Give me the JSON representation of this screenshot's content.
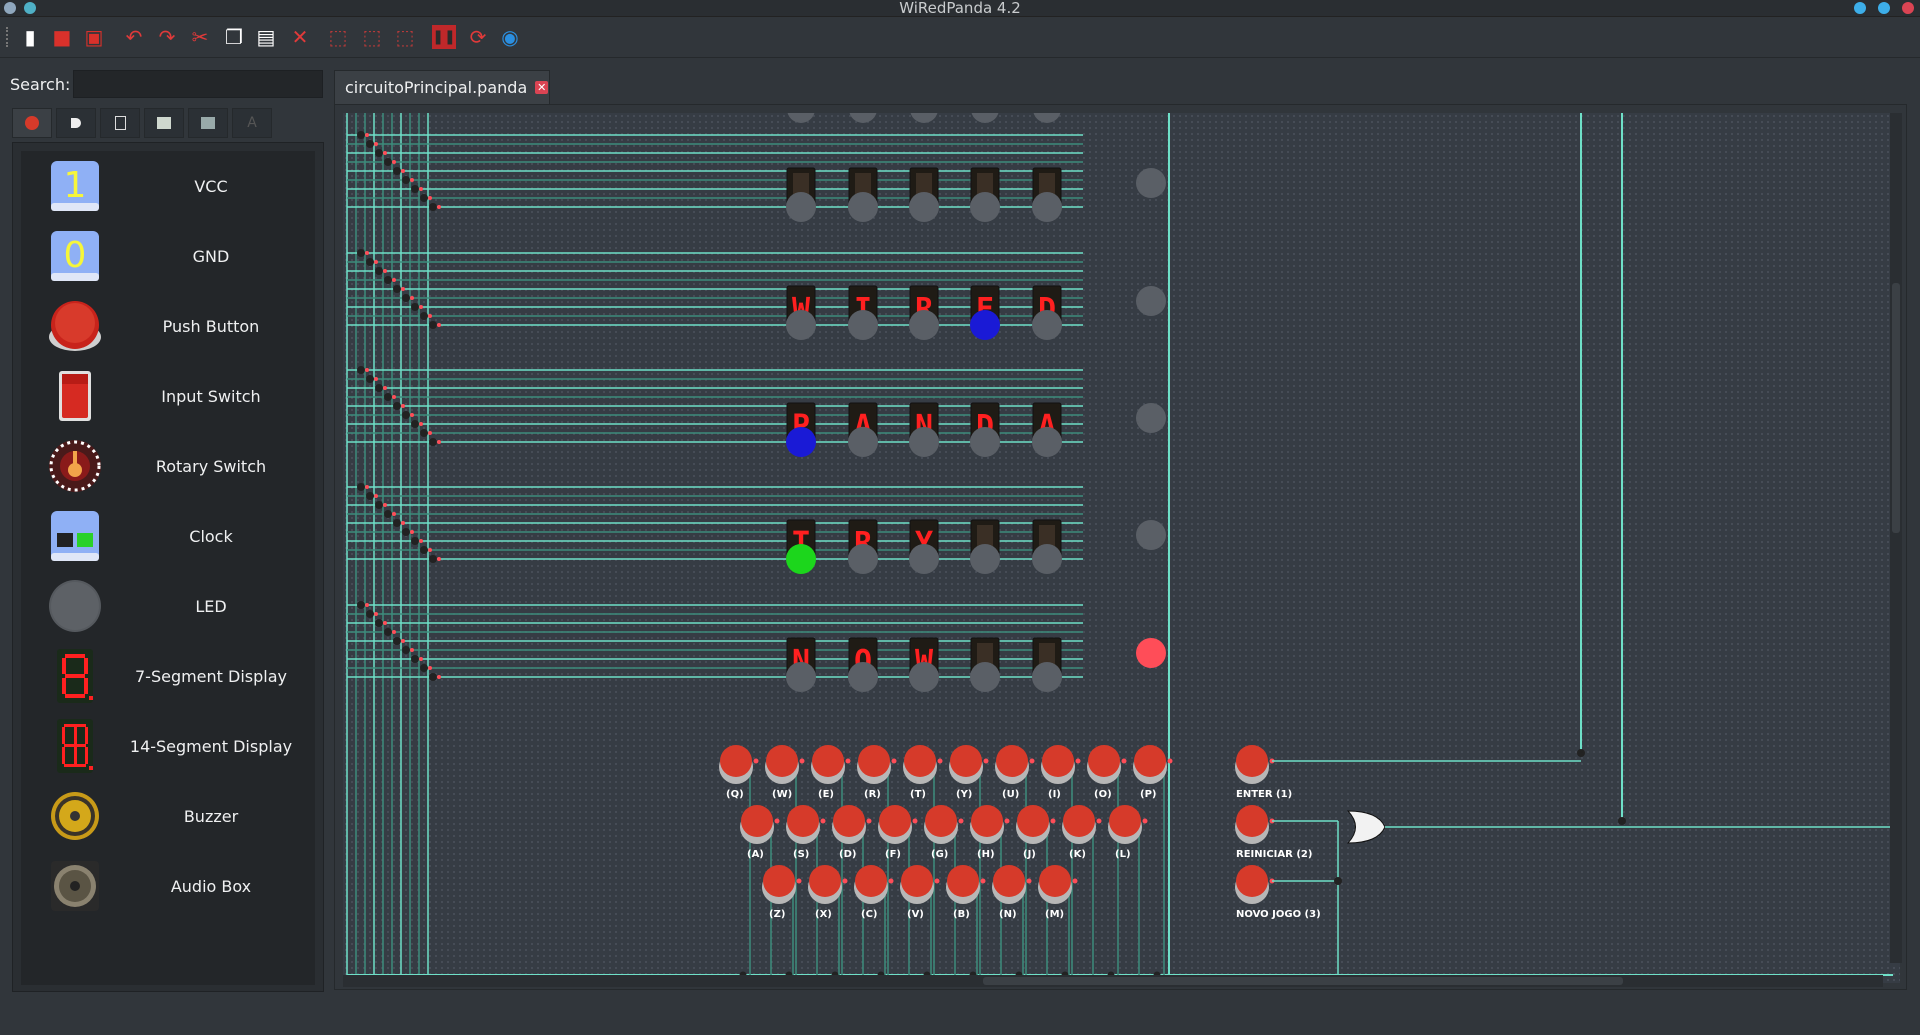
{
  "window": {
    "title": "WiRedPanda 4.2"
  },
  "toolbar": {
    "buttons": [
      {
        "name": "new-file-icon",
        "glyph": "▮",
        "color": "#ffffff"
      },
      {
        "name": "open-folder-icon",
        "glyph": "■",
        "color": "#d9312b"
      },
      {
        "name": "save-icon",
        "glyph": "▣",
        "color": "#d9312b"
      },
      {
        "name": "undo-icon",
        "glyph": "↶",
        "color": "#e03a3a"
      },
      {
        "name": "redo-icon",
        "glyph": "↷",
        "color": "#e03a3a"
      },
      {
        "name": "cut-icon",
        "glyph": "✂",
        "color": "#e03a3a"
      },
      {
        "name": "copy-icon",
        "glyph": "❐",
        "color": "#ffffff"
      },
      {
        "name": "paste-icon",
        "glyph": "▤",
        "color": "#ffffff"
      },
      {
        "name": "delete-icon",
        "glyph": "✕",
        "color": "#e03a3a"
      },
      {
        "name": "zoom-in-icon",
        "glyph": "⬚",
        "color": "#b83a3a"
      },
      {
        "name": "zoom-out-icon",
        "glyph": "⬚",
        "color": "#b83a3a"
      },
      {
        "name": "zoom-reset-icon",
        "glyph": "⬚",
        "color": "#b83a3a"
      },
      {
        "name": "pause-icon",
        "glyph": "❚❚",
        "color": "#e03a3a"
      },
      {
        "name": "reset-simulation-icon",
        "glyph": "⟳",
        "color": "#e03a3a"
      },
      {
        "name": "panda-logo-icon",
        "glyph": "◉",
        "color": "#2b8fe0"
      }
    ]
  },
  "search": {
    "label": "Search:",
    "value": "",
    "placeholder": ""
  },
  "palette": {
    "tabs": [
      "basic-gates-tab",
      "logic-tab",
      "memory-tab",
      "ic-tab",
      "misc-tab",
      "text-tab"
    ],
    "items": [
      {
        "label": "VCC",
        "icon": "vcc-icon"
      },
      {
        "label": "GND",
        "icon": "gnd-icon"
      },
      {
        "label": "Push Button",
        "icon": "push-button-icon"
      },
      {
        "label": "Input Switch",
        "icon": "input-switch-icon"
      },
      {
        "label": "Rotary Switch",
        "icon": "rotary-switch-icon"
      },
      {
        "label": "Clock",
        "icon": "clock-icon"
      },
      {
        "label": "LED",
        "icon": "led-icon"
      },
      {
        "label": "7-Segment Display",
        "icon": "seven-segment-icon"
      },
      {
        "label": "14-Segment Display",
        "icon": "fourteen-segment-icon"
      },
      {
        "label": "Buzzer",
        "icon": "buzzer-icon"
      },
      {
        "label": "Audio Box",
        "icon": "audio-box-icon"
      }
    ]
  },
  "document": {
    "tab_label": "circuitoPrincipal.panda"
  },
  "circuit": {
    "display_rows": [
      [
        "",
        "",
        "",
        "",
        ""
      ],
      [
        "W",
        "I",
        "R",
        "E",
        "D"
      ],
      [
        "P",
        "A",
        "N",
        "D",
        "A"
      ],
      [
        "T",
        "R",
        "Y",
        "",
        ""
      ],
      [
        "N",
        "O",
        "W",
        "",
        ""
      ]
    ],
    "led_rows": [
      [
        "off",
        "off",
        "off",
        "off",
        "off"
      ],
      [
        "off",
        "off",
        "off",
        "blue",
        "off"
      ],
      [
        "blue",
        "off",
        "off",
        "off",
        "off"
      ],
      [
        "green",
        "off",
        "off",
        "off",
        "off"
      ],
      [
        "off",
        "off",
        "off",
        "off",
        "off"
      ]
    ],
    "status_leds": [
      "off",
      "off",
      "off",
      "off",
      "red"
    ],
    "keyboard_rows": [
      [
        "(Q)",
        "(W)",
        "(E)",
        "(R)",
        "(T)",
        "(Y)",
        "(U)",
        "(I)",
        "(O)",
        "(P)"
      ],
      [
        "(A)",
        "(S)",
        "(D)",
        "(F)",
        "(G)",
        "(H)",
        "(J)",
        "(K)",
        "(L)"
      ],
      [
        "(Z)",
        "(X)",
        "(C)",
        "(V)",
        "(B)",
        "(N)",
        "(M)"
      ]
    ],
    "control_buttons": [
      "ENTER (1)",
      "REINICIAR (2)",
      "NOVO JOGO (3)"
    ],
    "colors": {
      "wire_active": "#6fe0c8",
      "wire_dim": "#3d8c7c",
      "button_red": "#d63a2a",
      "led_off": "#5a5f66",
      "led_blue": "#1a1ad6",
      "led_green": "#1cd61c",
      "led_red": "#ff4d58",
      "segment_on": "#ff2020",
      "segment_off": "#3a2f25"
    }
  }
}
